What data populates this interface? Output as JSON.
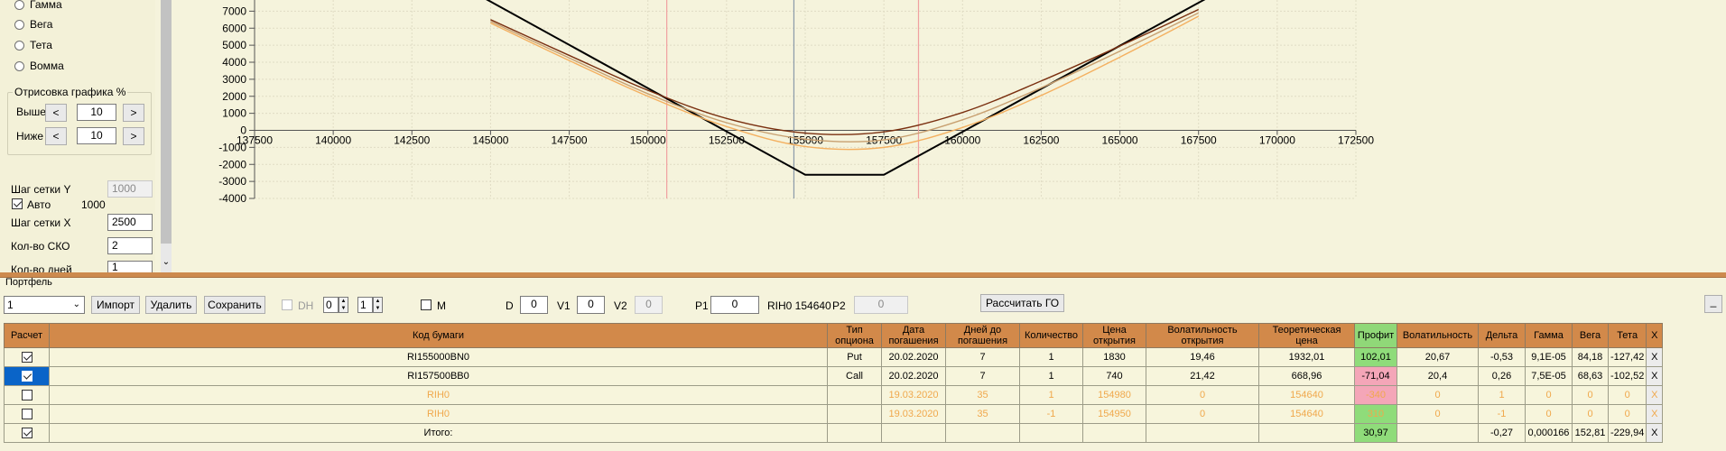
{
  "left_panel": {
    "radios": [
      "Гамма",
      "Вега",
      "Тета",
      "Вомма"
    ],
    "plot_group": {
      "title": "Отрисовка графика %",
      "above_label": "Выше",
      "above_value": "10",
      "below_label": "Ниже",
      "below_value": "10",
      "dec": "<",
      "inc": ">"
    },
    "grid_y_label": "Шаг сетки Y",
    "grid_y_value": "1000",
    "auto_label": "Авто",
    "auto_value": "1000",
    "grid_x_label": "Шаг сетки X",
    "grid_x_value": "2500",
    "sko_label": "Кол-во СКО",
    "sko_value": "2",
    "days_label": "Кол-во дней",
    "days_value": "1"
  },
  "chart_data": {
    "type": "line",
    "xlim": [
      137500,
      172500
    ],
    "ylim": [
      -4000,
      8000
    ],
    "x_ticks": [
      "137500",
      "140000",
      "142500",
      "145000",
      "147500",
      "150000",
      "152500",
      "155000",
      "157500",
      "160000",
      "162500",
      "165000",
      "167500",
      "170000",
      "172500"
    ],
    "y_ticks": [
      "-4000",
      "-3000",
      "-2000",
      "-1000",
      "0",
      "1000",
      "2000",
      "3000",
      "4000",
      "5000",
      "6000",
      "7000",
      "8000"
    ],
    "vlines": [
      {
        "x": 150600,
        "color": "#f0a0a0"
      },
      {
        "x": 154640,
        "color": "#8a9aa8"
      },
      {
        "x": 158600,
        "color": "#f0a0a0"
      }
    ],
    "series": [
      {
        "color": "#000000",
        "x": [
          144000,
          155000,
          157500,
          168000
        ],
        "y": [
          8580,
          -2610,
          -2610,
          8000
        ]
      },
      {
        "color": "#f4b060",
        "x": [
          145000,
          147500,
          150000,
          152500,
          155000,
          157500,
          160000,
          162500,
          165000,
          167500
        ],
        "y": [
          6300,
          4100,
          2000,
          220,
          -950,
          -1000,
          170,
          2050,
          4300,
          6700
        ]
      },
      {
        "color": "#7a3010",
        "x": [
          145000,
          147500,
          150000,
          152500,
          155000,
          157500,
          160000,
          162500,
          165000,
          167500
        ],
        "y": [
          6500,
          4400,
          2350,
          700,
          -160,
          -90,
          1050,
          2900,
          4950,
          7100
        ]
      },
      {
        "color": "#c8a070",
        "x": [
          145000,
          147500,
          150000,
          152500,
          155000,
          157500,
          160000,
          162500,
          165000,
          167500
        ],
        "y": [
          6400,
          4250,
          2150,
          450,
          -520,
          -560,
          620,
          2500,
          4650,
          6900
        ]
      }
    ]
  },
  "portfolio": {
    "title": "Портфель",
    "combo_value": "1",
    "import_label": "Импорт",
    "delete_label": "Удалить",
    "save_label": "Сохранить",
    "dh_label": "DH",
    "spin1": "0",
    "spin2": "1",
    "m_label": "M",
    "d_label": "D",
    "d_value": "0",
    "v1_label": "V1",
    "v1_value": "0",
    "v2_label": "V2",
    "v2_value": "0",
    "p1_label": "P1",
    "p1_value": "0",
    "rih_label": "RIH0 154640",
    "p2_label": "P2",
    "p2_value": "0",
    "calc_label": "Рассчитать ГО",
    "more_label": "_"
  },
  "table": {
    "headers": [
      "Расчет",
      "Код бумаги",
      "Тип опциона",
      "Дата погашения",
      "Дней до погашения",
      "Количество",
      "Цена открытия",
      "Волатильность открытия",
      "Теоретическая цена",
      "Профит",
      "Волатильность",
      "Дельта",
      "Гамма",
      "Вега",
      "Тета",
      "X"
    ],
    "rows": [
      {
        "checked": true,
        "selected": false,
        "dim": false,
        "code": "RI155000BN0",
        "type": "Put",
        "date": "20.02.2020",
        "days": "7",
        "qty": "1",
        "price": "1830",
        "vol_open": "19,46",
        "theor": "1932,01",
        "profit": "102,01",
        "profit_color": "green",
        "vol": "20,67",
        "delta": "-0,53",
        "gamma": "9,1E-05",
        "vega": "84,18",
        "theta": "-127,42",
        "x": "X"
      },
      {
        "checked": true,
        "selected": true,
        "dim": false,
        "code": "RI157500BB0",
        "type": "Call",
        "date": "20.02.2020",
        "days": "7",
        "qty": "1",
        "price": "740",
        "vol_open": "21,42",
        "theor": "668,96",
        "profit": "-71,04",
        "profit_color": "red",
        "vol": "20,4",
        "delta": "0,26",
        "gamma": "7,5E-05",
        "vega": "68,63",
        "theta": "-102,52",
        "x": "X"
      },
      {
        "checked": false,
        "selected": false,
        "dim": true,
        "code": "RIH0",
        "type": "",
        "date": "19.03.2020",
        "days": "35",
        "qty": "1",
        "price": "154980",
        "vol_open": "0",
        "theor": "154640",
        "profit": "-340",
        "profit_color": "red",
        "vol": "0",
        "delta": "1",
        "gamma": "0",
        "vega": "0",
        "theta": "0",
        "x": "X"
      },
      {
        "checked": false,
        "selected": false,
        "dim": true,
        "code": "RIH0",
        "type": "",
        "date": "19.03.2020",
        "days": "35",
        "qty": "-1",
        "price": "154950",
        "vol_open": "0",
        "theor": "154640",
        "profit": "310",
        "profit_color": "green",
        "vol": "0",
        "delta": "-1",
        "gamma": "0",
        "vega": "0",
        "theta": "0",
        "x": "X"
      },
      {
        "checked": true,
        "selected": false,
        "dim": false,
        "code": "Итого:",
        "type": "",
        "date": "",
        "days": "",
        "qty": "",
        "price": "",
        "vol_open": "",
        "theor": "",
        "profit": "30,97",
        "profit_color": "green",
        "vol": "",
        "delta": "-0,27",
        "gamma": "0,000166",
        "vega": "152,81",
        "theta": "-229,94",
        "x": "X"
      }
    ]
  }
}
